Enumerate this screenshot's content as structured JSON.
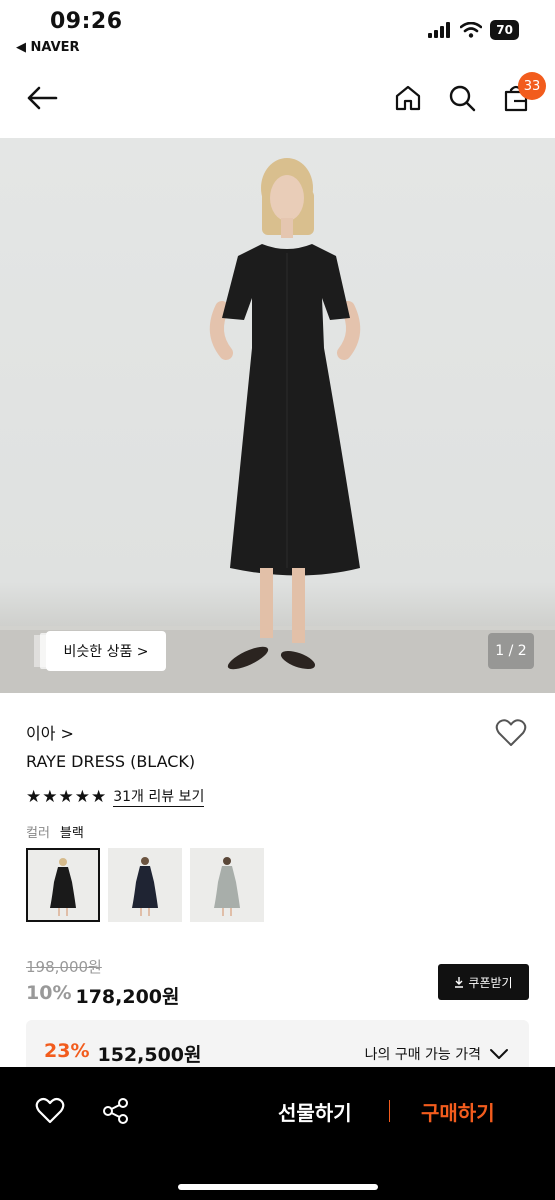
{
  "status": {
    "time": "09:26",
    "back_app": "◀ NAVER",
    "battery": "70"
  },
  "nav": {
    "cart_count": "33"
  },
  "gallery": {
    "similar_label": "비슷한 상품 >",
    "counter": "1 / 2"
  },
  "product": {
    "brand": "이아 >",
    "name": "RAYE DRESS (BLACK)",
    "stars": "★★★★★",
    "review_link": "31개 리뷰 보기",
    "color_label": "컬러",
    "color_value": "블랙",
    "original_price": "198,000원",
    "discount_rate": "10%",
    "sale_price": "178,200원",
    "coupon_label": "쿠폰받기",
    "best_discount": "23%",
    "best_price": "152,500원",
    "best_label": "나의 구매 가능 가격"
  },
  "actions": {
    "gift": "선물하기",
    "buy": "구매하기"
  },
  "colors": {
    "accent": "#f25c1d",
    "dark": "#111111"
  }
}
